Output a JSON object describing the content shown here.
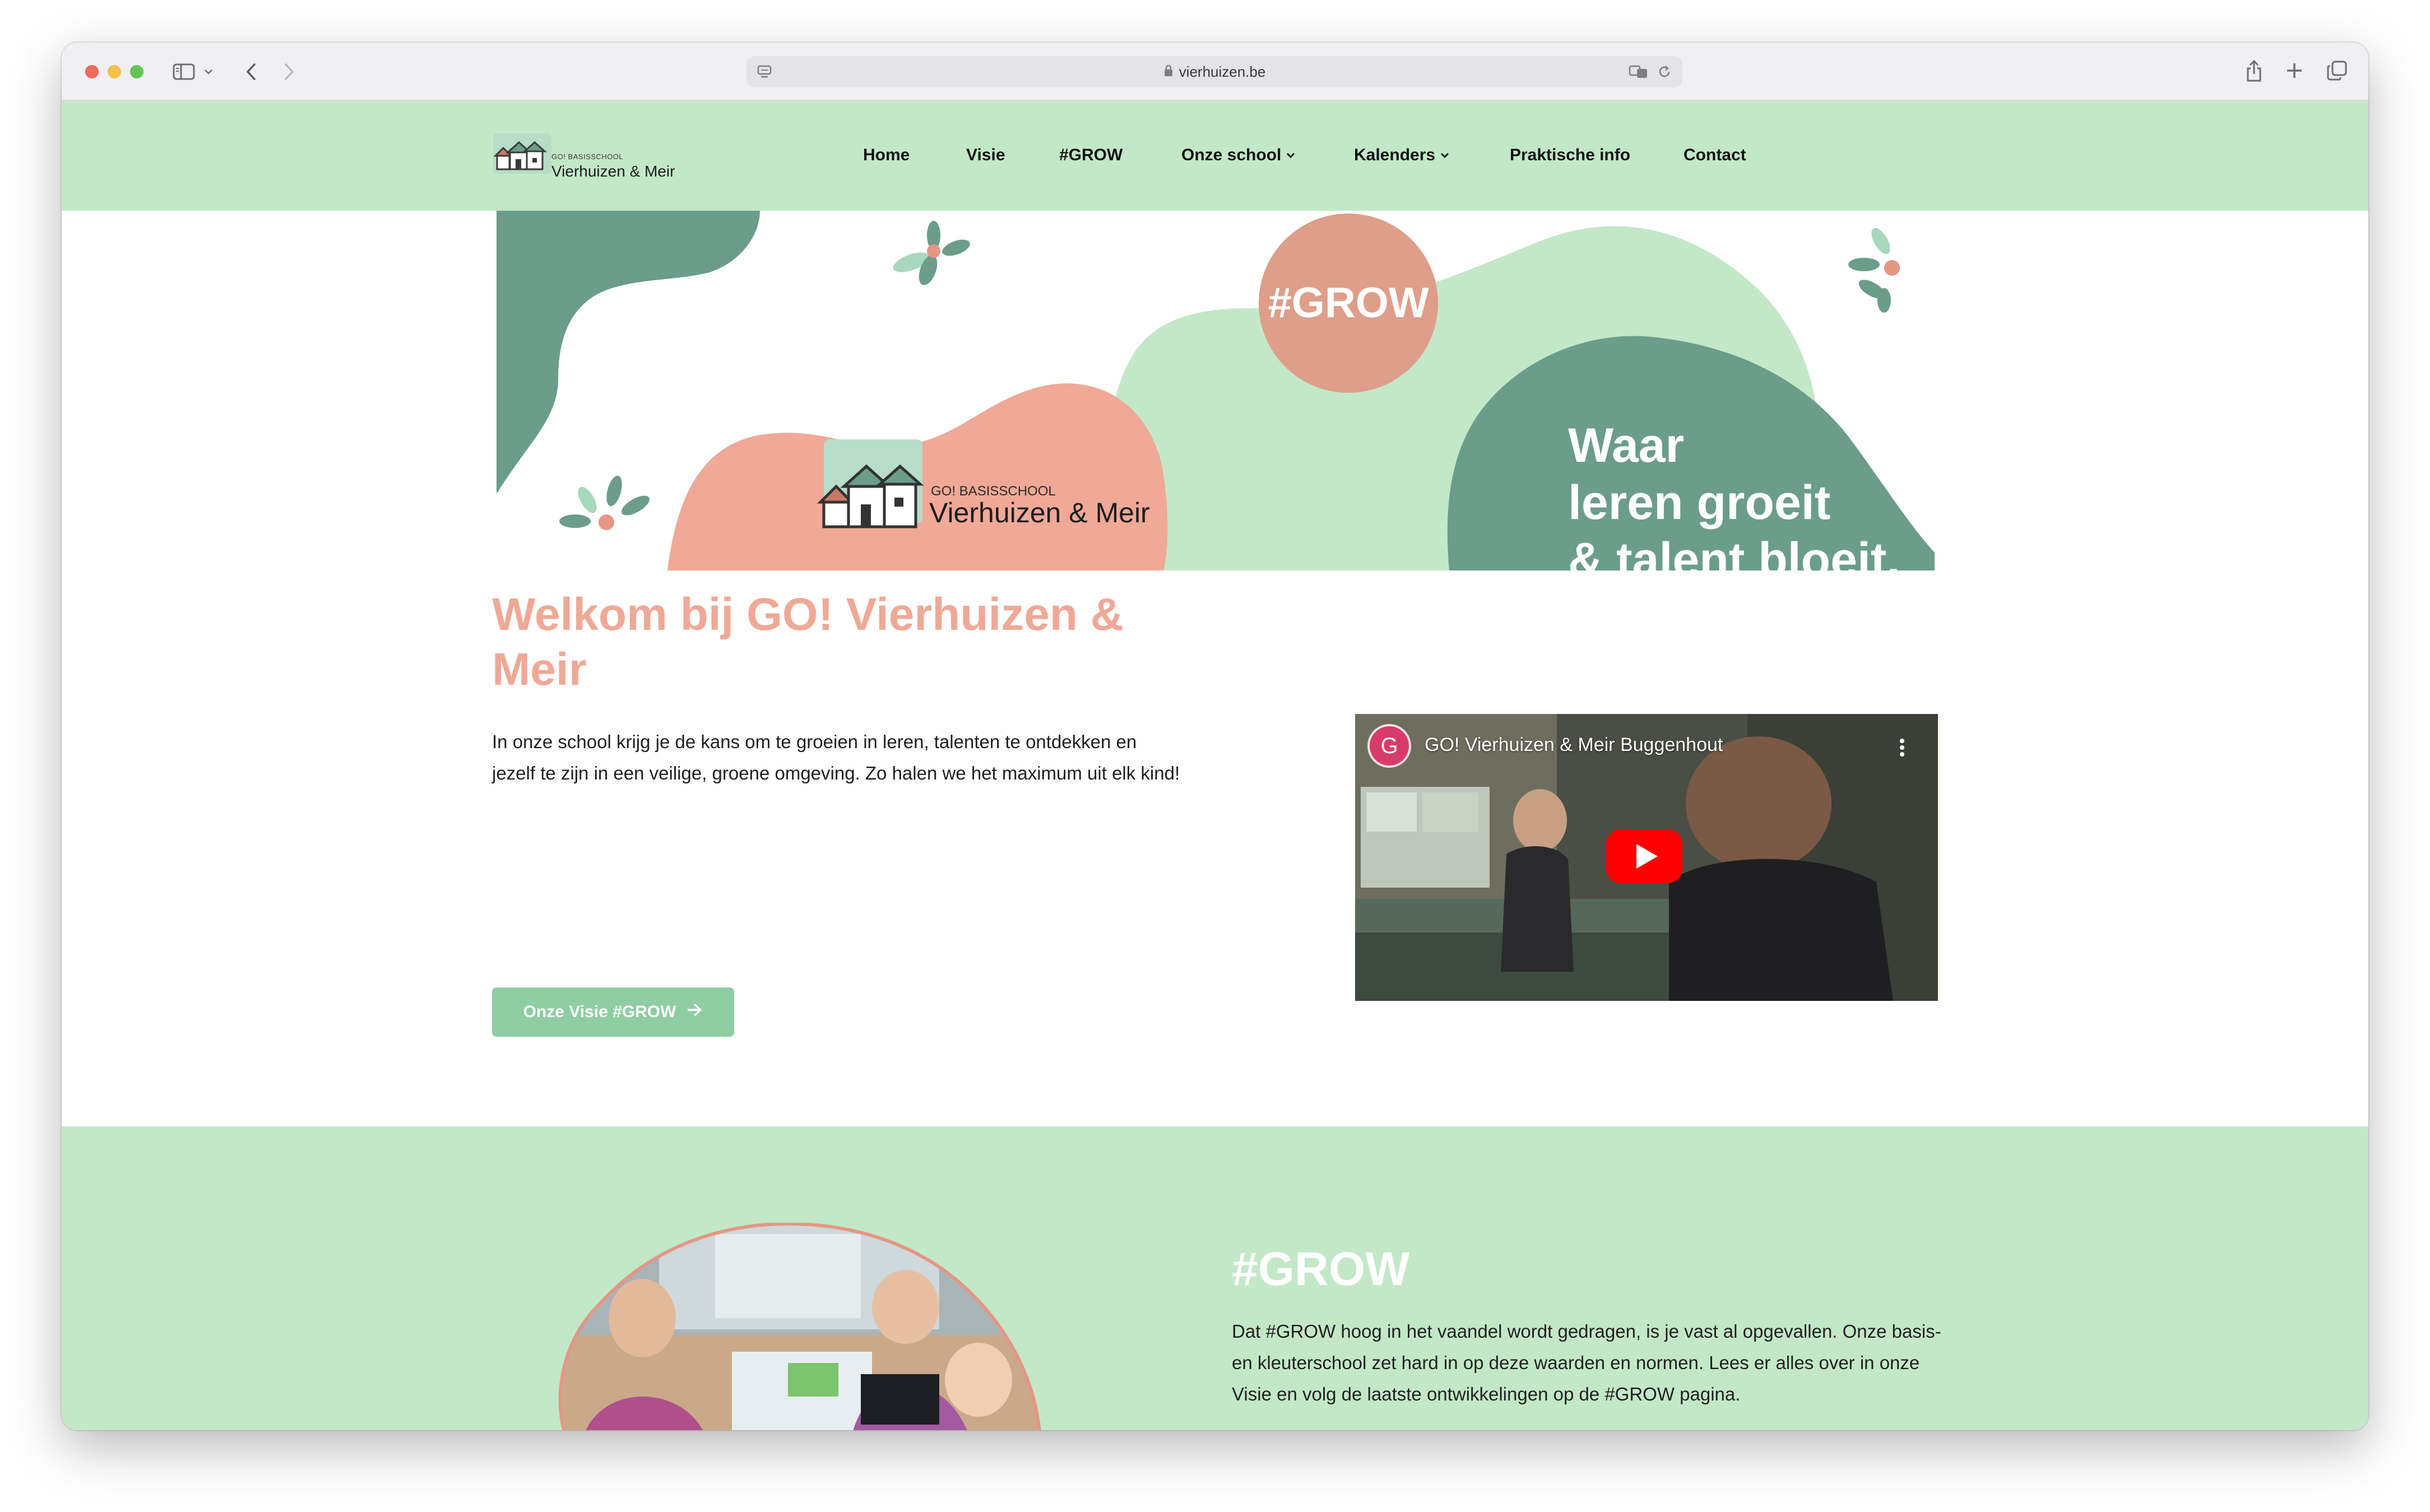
{
  "browser": {
    "url": "vierhuizen.be"
  },
  "header": {
    "logo_small": "GO! BASISSCHOOL",
    "logo_big": "Vierhuizen & Meir",
    "nav": [
      "Home",
      "Visie",
      "#GROW",
      "Onze school",
      "Kalenders",
      "Praktische info",
      "Contact"
    ]
  },
  "banner": {
    "badge": "#GROW",
    "slogan_line1": "Waar",
    "slogan_line2": "leren groeit",
    "slogan_line3": "& talent bloeit.",
    "logo_small": "GO! BASISSCHOOL",
    "logo_big": "Vierhuizen & Meir"
  },
  "welcome": {
    "title": "Welkom bij GO! Vierhuizen & Meir",
    "text": "In onze school krijg je de kans om te groeien in leren, talenten te ontdekken en jezelf te zijn in een veilige, groene omgeving. Zo halen we het maximum uit elk kind!",
    "button": "Onze Visie #GROW"
  },
  "video": {
    "avatar_letter": "G",
    "title": "GO! Vierhuizen & Meir Buggenhout"
  },
  "grow": {
    "title": "#GROW",
    "text": "Dat #GROW hoog in het vaandel wordt gedragen, is je vast al opgevallen. Onze basis- en kleuterschool zet hard in op deze waarden en normen. Lees er alles over in onze Visie en volg de laatste ontwikkelingen op de #GROW pagina."
  },
  "colors": {
    "mint": "#c3e8c8",
    "teal": "#6b9d8a",
    "salmon": "#efa996",
    "button": "#8fcda3"
  }
}
